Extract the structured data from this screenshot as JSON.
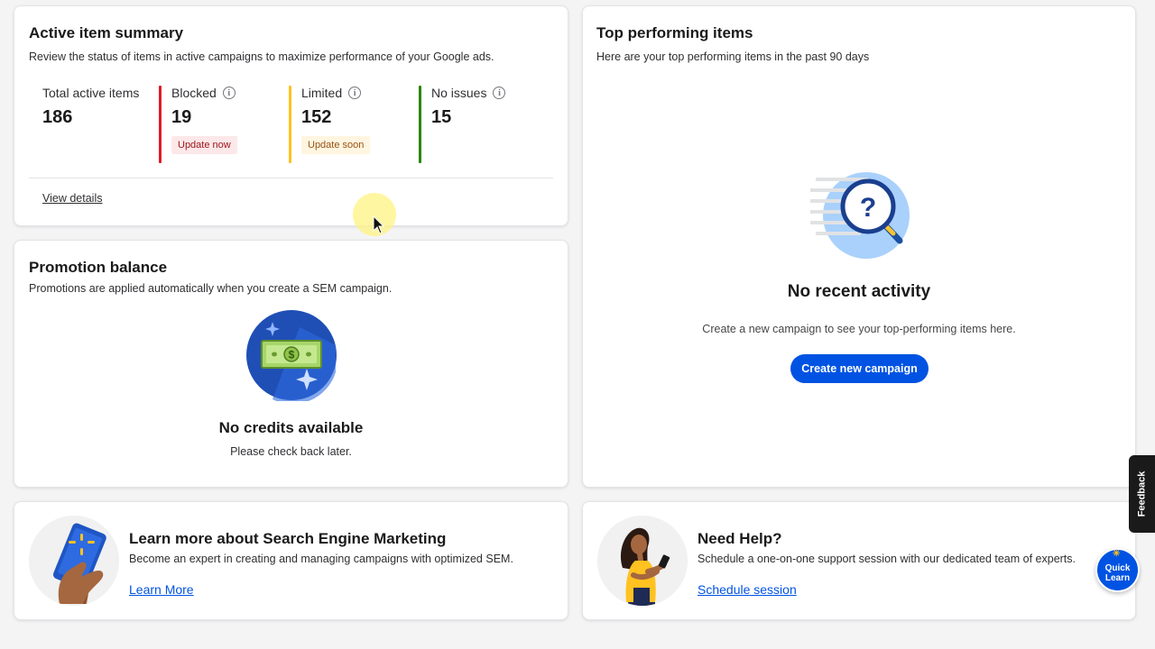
{
  "summary": {
    "title": "Active item summary",
    "subtitle": "Review the status of items in active campaigns to maximize performance of your Google ads.",
    "stats": [
      {
        "label": "Total active items",
        "value": "186"
      },
      {
        "label": "Blocked",
        "value": "19",
        "tag": "Update now",
        "color": "#de1c24"
      },
      {
        "label": "Limited",
        "value": "152",
        "tag": "Update soon",
        "color": "#ffc220"
      },
      {
        "label": "No issues",
        "value": "15",
        "color": "#2a8703"
      }
    ],
    "view_details": "View details"
  },
  "promo": {
    "title": "Promotion balance",
    "subtitle": "Promotions are applied automatically when you create a SEM campaign.",
    "empty_title": "No credits available",
    "empty_sub": "Please check back later."
  },
  "top": {
    "title": "Top performing items",
    "subtitle": "Here are your top performing items in the past 90 days",
    "empty_title": "No recent activity",
    "empty_sub": "Create a new campaign to see your top-performing items here.",
    "button": "Create new campaign"
  },
  "learn": {
    "title": "Learn more about Search Engine Marketing",
    "subtitle": "Become an expert in creating and managing campaigns with optimized SEM.",
    "link": "Learn More"
  },
  "help": {
    "title": "Need Help?",
    "subtitle": "Schedule a one-on-one support session with our dedicated team of experts.",
    "link": "Schedule session"
  },
  "feedback": "Feedback",
  "quick_learn": {
    "line1": "Quick",
    "line2": "Learn"
  },
  "colors": {
    "primary": "#0053e2",
    "spark": "#ffc220"
  },
  "icons": [
    "info-icon",
    "dollar-bill-icon",
    "magnifier-question-icon",
    "phone-spark-icon",
    "person-phone-icon",
    "mouse-cursor-icon"
  ]
}
